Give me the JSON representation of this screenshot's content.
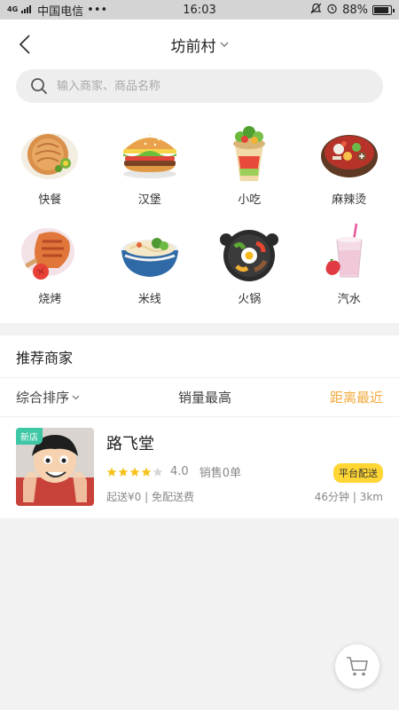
{
  "statusbar": {
    "network": "4G",
    "carrier": "中国电信",
    "dots": "•••",
    "time": "16:03",
    "battery": "88%",
    "battery_level": 0.88
  },
  "header": {
    "title": "坊前村",
    "back_icon": "back-arrow-icon",
    "dropdown_icon": "chevron-down-icon"
  },
  "search": {
    "placeholder": "输入商家、商品名称"
  },
  "categories": [
    {
      "label": "快餐",
      "icon": "pizza-icon"
    },
    {
      "label": "汉堡",
      "icon": "burger-icon"
    },
    {
      "label": "小吃",
      "icon": "wrap-icon"
    },
    {
      "label": "麻辣烫",
      "icon": "hotpot-bowl-icon"
    },
    {
      "label": "烧烤",
      "icon": "bbq-icon"
    },
    {
      "label": "米线",
      "icon": "noodle-bowl-icon"
    },
    {
      "label": "火锅",
      "icon": "hotpot-icon"
    },
    {
      "label": "汽水",
      "icon": "drink-icon"
    }
  ],
  "section": {
    "title": "推荐商家"
  },
  "sort": {
    "comprehensive": "综合排序",
    "sales": "销量最高",
    "distance": "距离最近"
  },
  "shop": {
    "name": "路飞堂",
    "new_badge": "新店",
    "rating": "4.0",
    "rating_value": 4,
    "sales": "销售0单",
    "platform": "平台配送",
    "delivery": "起送¥0 | 免配送费",
    "time_distance": "46分钟 | 3km"
  },
  "colors": {
    "accent": "#f2a93b",
    "badge_green": "#3ec7a5",
    "badge_yellow": "#ffd633"
  }
}
